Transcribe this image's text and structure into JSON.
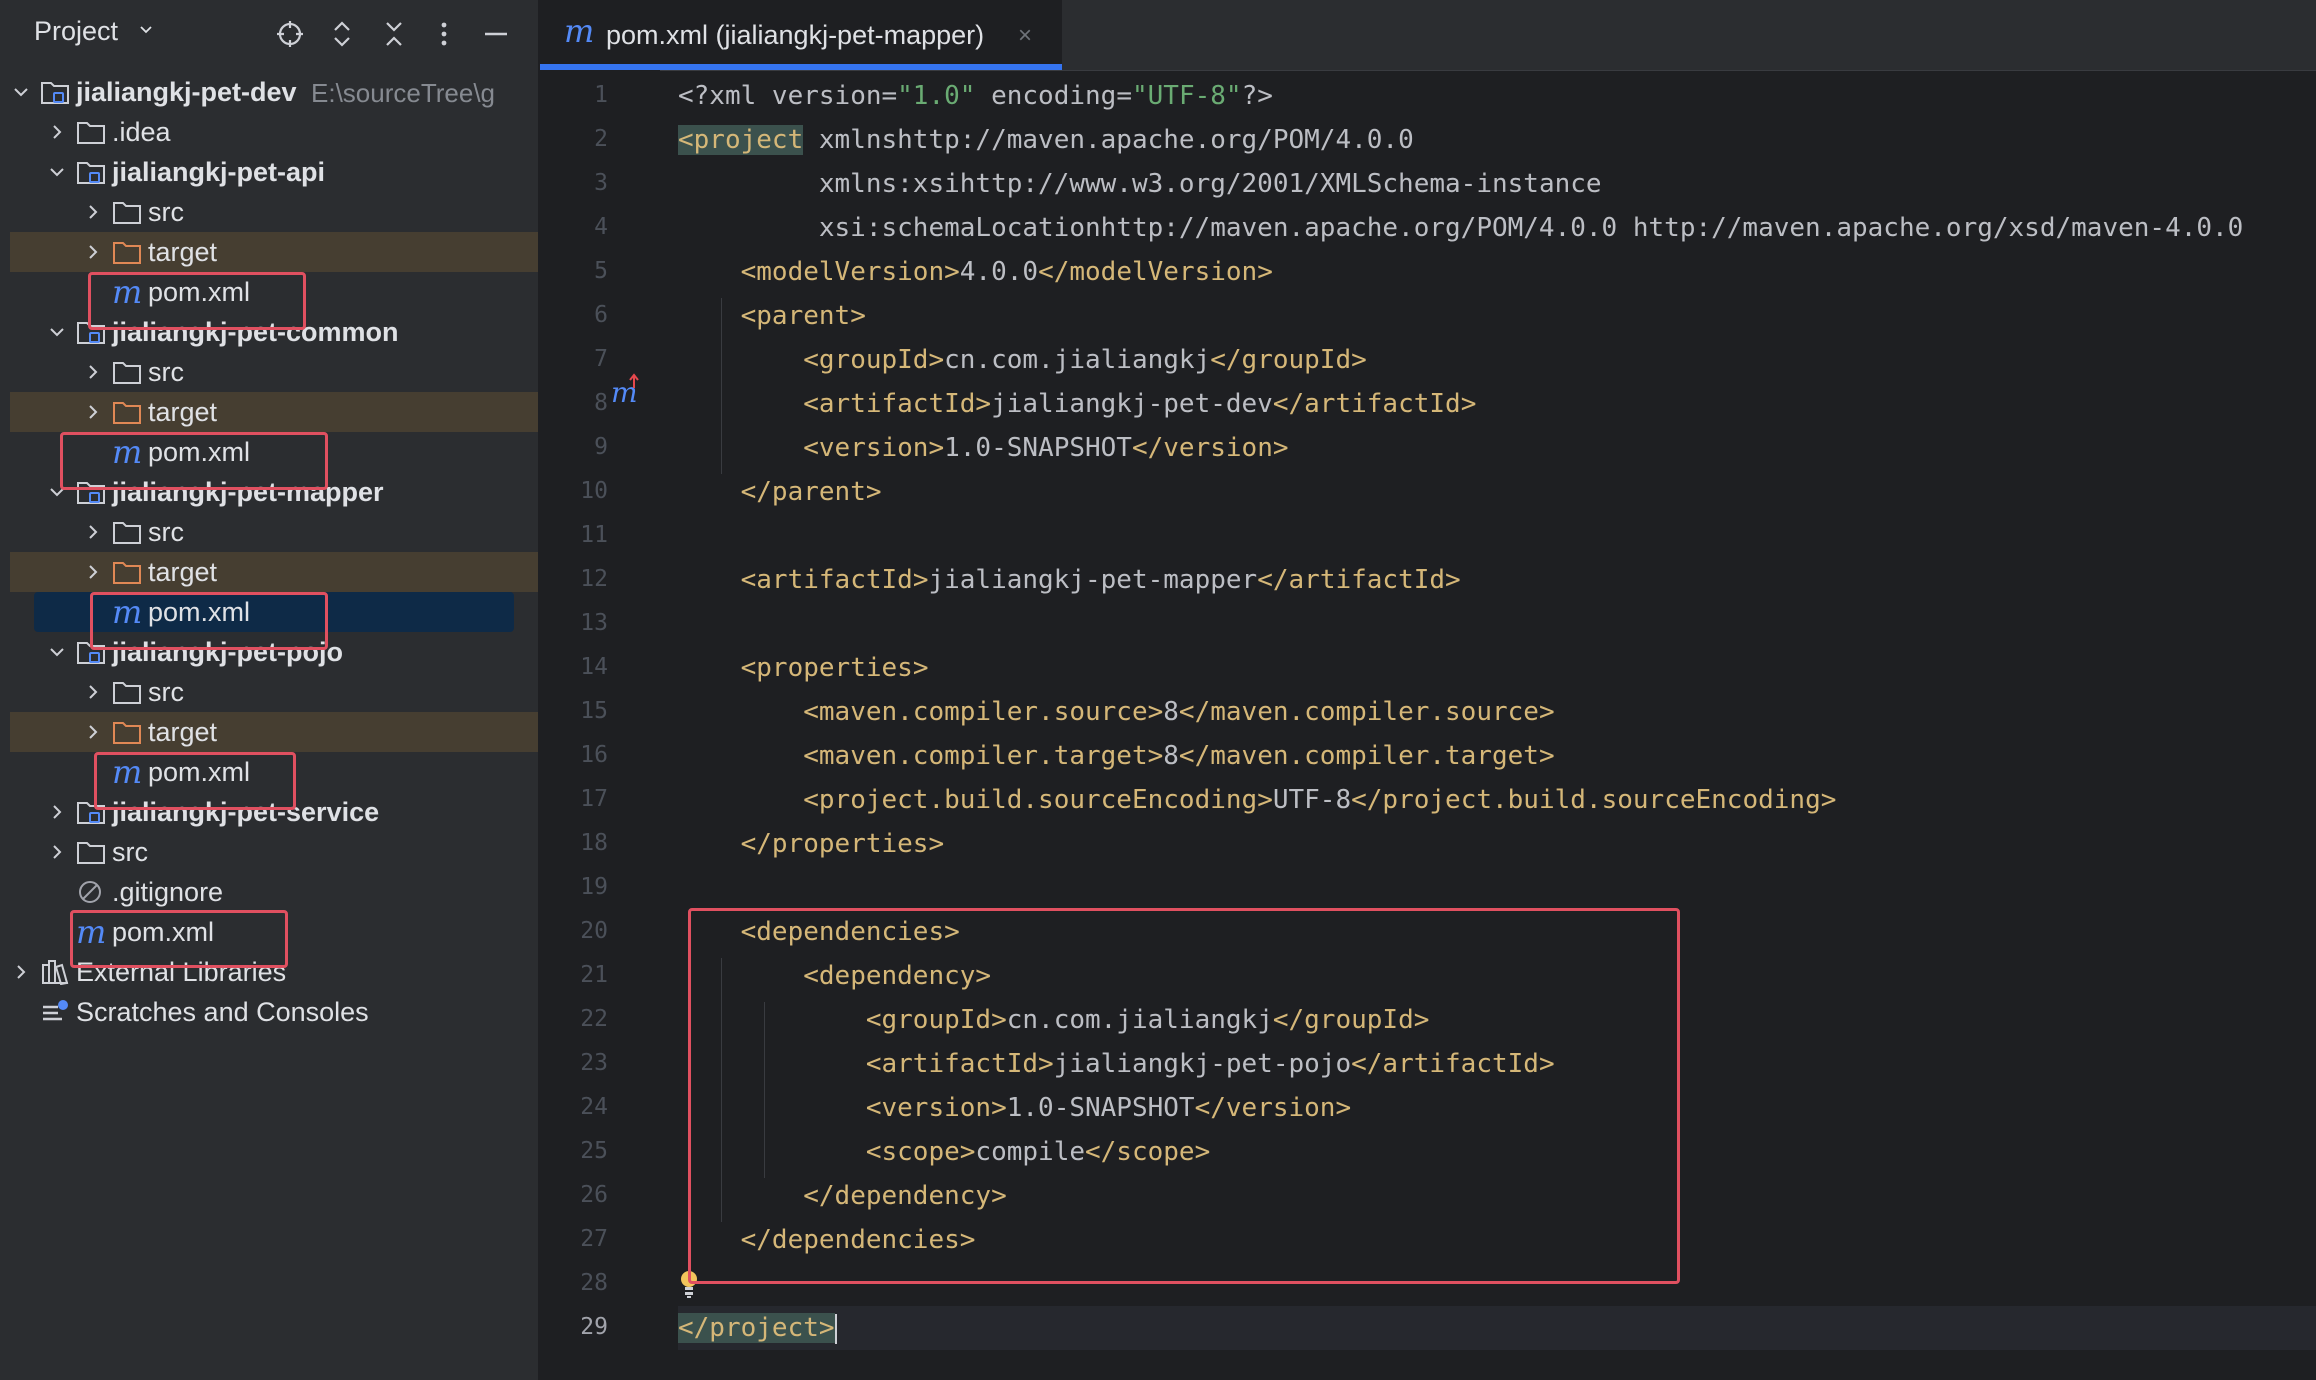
{
  "project_panel": {
    "title": "Project",
    "tree": [
      {
        "label": "jialiangkj-pet-dev",
        "path": "E:\\sourceTree\\g",
        "type": "module",
        "expanded": true,
        "depth": 0
      },
      {
        "label": ".idea",
        "type": "folder",
        "expanded": false,
        "depth": 1
      },
      {
        "label": "jialiangkj-pet-api",
        "type": "module",
        "expanded": true,
        "depth": 1
      },
      {
        "label": "src",
        "type": "folder",
        "expanded": false,
        "depth": 2
      },
      {
        "label": "target",
        "type": "folder-excluded",
        "expanded": false,
        "depth": 2
      },
      {
        "label": "pom.xml",
        "type": "maven",
        "depth": 2
      },
      {
        "label": "jialiangkj-pet-common",
        "type": "module",
        "expanded": true,
        "depth": 1
      },
      {
        "label": "src",
        "type": "folder",
        "expanded": false,
        "depth": 2
      },
      {
        "label": "target",
        "type": "folder-excluded",
        "expanded": false,
        "depth": 2
      },
      {
        "label": "pom.xml",
        "type": "maven",
        "depth": 2
      },
      {
        "label": "jialiangkj-pet-mapper",
        "type": "module",
        "expanded": true,
        "depth": 1
      },
      {
        "label": "src",
        "type": "folder",
        "expanded": false,
        "depth": 2
      },
      {
        "label": "target",
        "type": "folder-excluded",
        "expanded": false,
        "depth": 2
      },
      {
        "label": "pom.xml",
        "type": "maven",
        "depth": 2,
        "selected": true
      },
      {
        "label": "jialiangkj-pet-pojo",
        "type": "module",
        "expanded": true,
        "depth": 1
      },
      {
        "label": "src",
        "type": "folder",
        "expanded": false,
        "depth": 2
      },
      {
        "label": "target",
        "type": "folder-excluded",
        "expanded": false,
        "depth": 2
      },
      {
        "label": "pom.xml",
        "type": "maven",
        "depth": 2
      },
      {
        "label": "jialiangkj-pet-service",
        "type": "module",
        "expanded": false,
        "depth": 1
      },
      {
        "label": "src",
        "type": "folder",
        "expanded": false,
        "depth": 1
      },
      {
        "label": ".gitignore",
        "type": "ignore",
        "depth": 1
      },
      {
        "label": "pom.xml",
        "type": "maven",
        "depth": 1
      },
      {
        "label": "External Libraries",
        "type": "libraries",
        "expanded": false,
        "depth": 0
      },
      {
        "label": "Scratches and Consoles",
        "type": "scratches",
        "depth": 0
      }
    ]
  },
  "editor": {
    "tab": {
      "label": "pom.xml (jialiangkj-pet-mapper)",
      "close": "×"
    },
    "current_line": 29,
    "lines": [
      "<?xml version=\"1.0\" encoding=\"UTF-8\"?>",
      "<project xmlns=\"http://maven.apache.org/POM/4.0.0\"",
      "         xmlns:xsi=\"http://www.w3.org/2001/XMLSchema-instance\"",
      "         xsi:schemaLocation=\"http://maven.apache.org/POM/4.0.0 http://maven.apache.org/xsd/maven-4.0.0",
      "    <modelVersion>4.0.0</modelVersion>",
      "    <parent>",
      "        <groupId>cn.com.jialiangkj</groupId>",
      "        <artifactId>jialiangkj-pet-dev</artifactId>",
      "        <version>1.0-SNAPSHOT</version>",
      "    </parent>",
      "",
      "    <artifactId>jialiangkj-pet-mapper</artifactId>",
      "",
      "    <properties>",
      "        <maven.compiler.source>8</maven.compiler.source>",
      "        <maven.compiler.target>8</maven.compiler.target>",
      "        <project.build.sourceEncoding>UTF-8</project.build.sourceEncoding>",
      "    </properties>",
      "",
      "    <dependencies>",
      "        <dependency>",
      "            <groupId>cn.com.jialiangkj</groupId>",
      "            <artifactId>jialiangkj-pet-pojo</artifactId>",
      "            <version>1.0-SNAPSHOT</version>",
      "            <scope>compile</scope>",
      "        </dependency>",
      "    </dependencies>",
      "",
      "</project>"
    ]
  },
  "colors": {
    "tag": "#d5b778",
    "attr_value": "#6aab73",
    "namespace": "#c77dbb",
    "annotation_box": "#e05060",
    "accent": "#3574f0"
  }
}
